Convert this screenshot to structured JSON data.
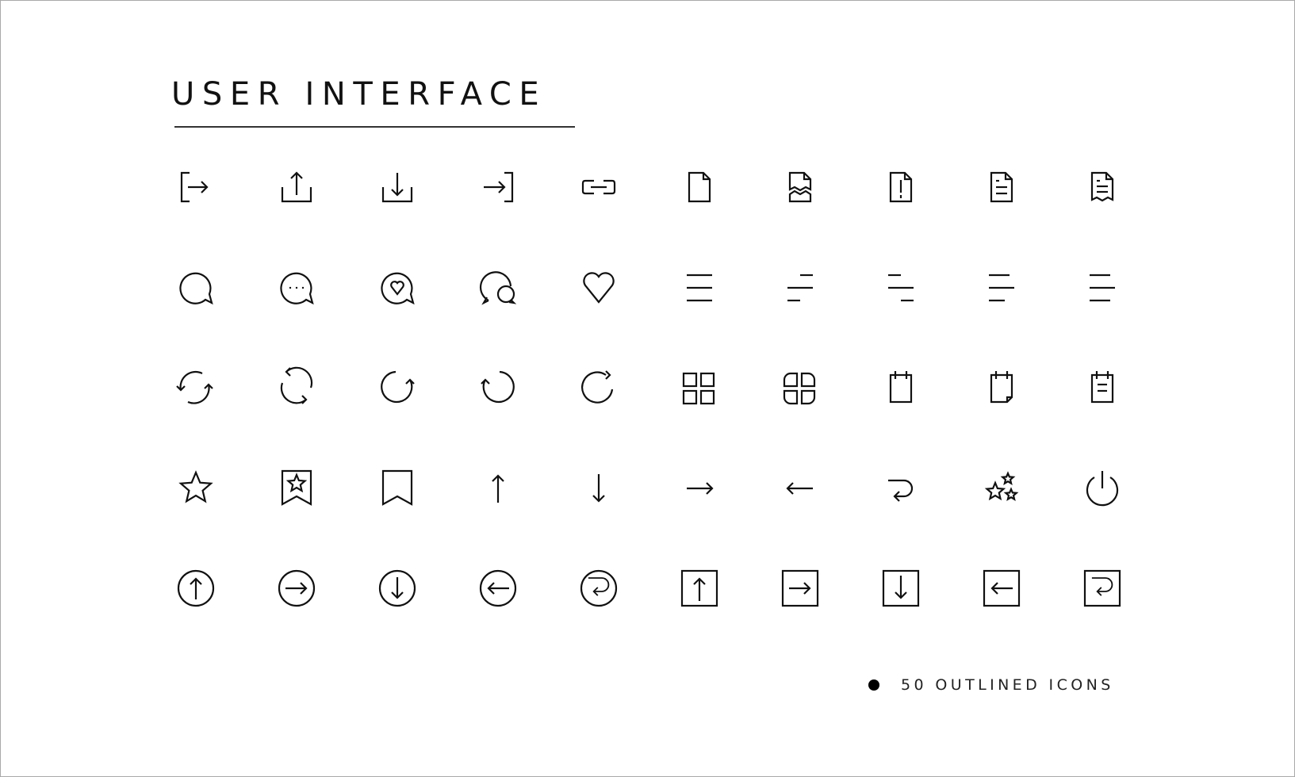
{
  "title": "USER INTERFACE",
  "footer": {
    "label": "50 OUTLINED ICONS",
    "bullet": "bullet-dot"
  },
  "colors": {
    "stroke": "#111111",
    "background": "#ffffff",
    "frame": "#a9a9a9"
  },
  "icons": [
    [
      "logout",
      "upload",
      "download",
      "login",
      "link",
      "file",
      "file-broken",
      "file-alert",
      "file-text",
      "receipt"
    ],
    [
      "chat-bubble",
      "chat-dots",
      "chat-heart",
      "chat-multiple",
      "heart",
      "align-justify",
      "align-right",
      "align-indent",
      "align-left",
      "align-left-short"
    ],
    [
      "sync",
      "refresh-cycle",
      "rotate-clockwise-open",
      "rotate-counterclockwise",
      "redo-rotate",
      "grid-squares",
      "grid-rounded",
      "notepad",
      "notepad-folded",
      "notepad-text"
    ],
    [
      "star",
      "bookmark-star",
      "bookmark",
      "arrow-up",
      "arrow-down",
      "arrow-right",
      "arrow-left",
      "return",
      "stars",
      "power"
    ],
    [
      "circle-arrow-up",
      "circle-arrow-right",
      "circle-arrow-down",
      "circle-arrow-left",
      "circle-return",
      "square-arrow-up",
      "square-arrow-right",
      "square-arrow-down",
      "square-arrow-left",
      "square-return"
    ]
  ]
}
